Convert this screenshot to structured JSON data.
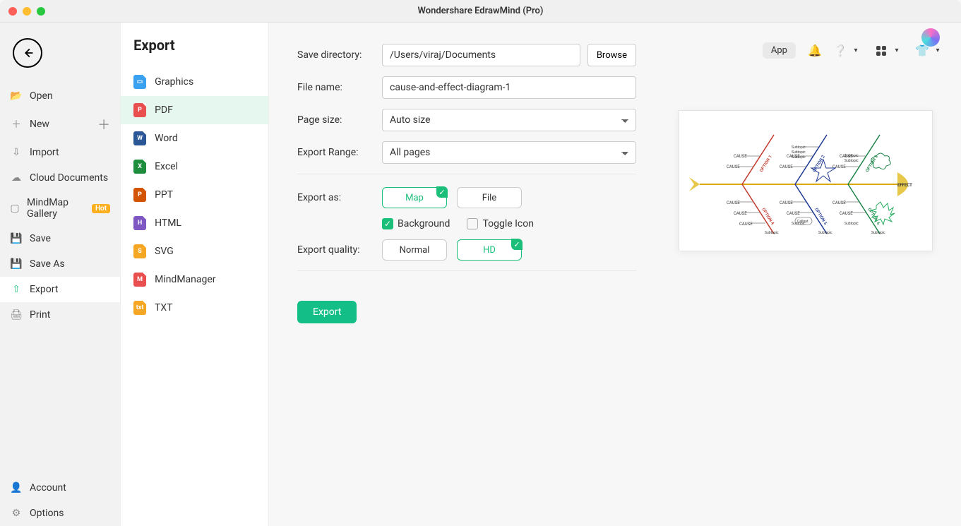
{
  "window": {
    "title": "Wondershare EdrawMind (Pro)"
  },
  "topbar": {
    "app": "App"
  },
  "sidebar": {
    "items": [
      {
        "label": "Open"
      },
      {
        "label": "New"
      },
      {
        "label": "Import"
      },
      {
        "label": "Cloud Documents"
      },
      {
        "label": "MindMap Gallery",
        "hot": "Hot"
      },
      {
        "label": "Save"
      },
      {
        "label": "Save As"
      },
      {
        "label": "Export"
      },
      {
        "label": "Print"
      }
    ],
    "footer": [
      {
        "label": "Account"
      },
      {
        "label": "Options"
      }
    ]
  },
  "export_panel": {
    "title": "Export",
    "formats": [
      {
        "label": "Graphics"
      },
      {
        "label": "PDF"
      },
      {
        "label": "Word"
      },
      {
        "label": "Excel"
      },
      {
        "label": "PPT"
      },
      {
        "label": "HTML"
      },
      {
        "label": "SVG"
      },
      {
        "label": "MindManager"
      },
      {
        "label": "TXT"
      }
    ]
  },
  "form": {
    "save_dir_label": "Save directory:",
    "save_dir_value": "/Users/viraj/Documents",
    "browse": "Browse",
    "filename_label": "File name:",
    "filename_value": "cause-and-effect-diagram-1",
    "pagesize_label": "Page size:",
    "pagesize_value": "Auto size",
    "range_label": "Export Range:",
    "range_value": "All pages",
    "exportas_label": "Export as:",
    "map": "Map",
    "file": "File",
    "background": "Background",
    "toggle_icon": "Toggle Icon",
    "quality_label": "Export quality:",
    "normal": "Normal",
    "hd": "HD",
    "export_btn": "Export"
  },
  "preview": {
    "effect": "EFFECT",
    "cause": "CAUSE",
    "subtopic": "Subtopic",
    "callout": "Callout",
    "options": [
      "OPTION 1",
      "OPTION 2",
      "OPTION 3",
      "OPTION 4",
      "OPTION 5",
      "OPTION 6"
    ]
  }
}
